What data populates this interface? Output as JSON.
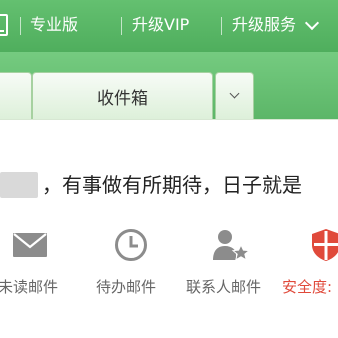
{
  "header": {
    "edition": "专业版",
    "upgrade_vip": "升级VIP",
    "upgrade_service": "升级服务"
  },
  "tabs": {
    "inbox": "收件箱"
  },
  "greeting": "，有事做有所期待，日子就是",
  "quick_links": [
    {
      "label": "未读邮件",
      "icon": "envelope-icon"
    },
    {
      "label": "待办邮件",
      "icon": "clock-icon"
    },
    {
      "label": "联系人邮件",
      "icon": "contact-star-icon"
    },
    {
      "label": "安全度:",
      "icon": "shield-icon"
    }
  ],
  "colors": {
    "brand_green": "#56b463",
    "warning_red": "#e04a3b"
  }
}
